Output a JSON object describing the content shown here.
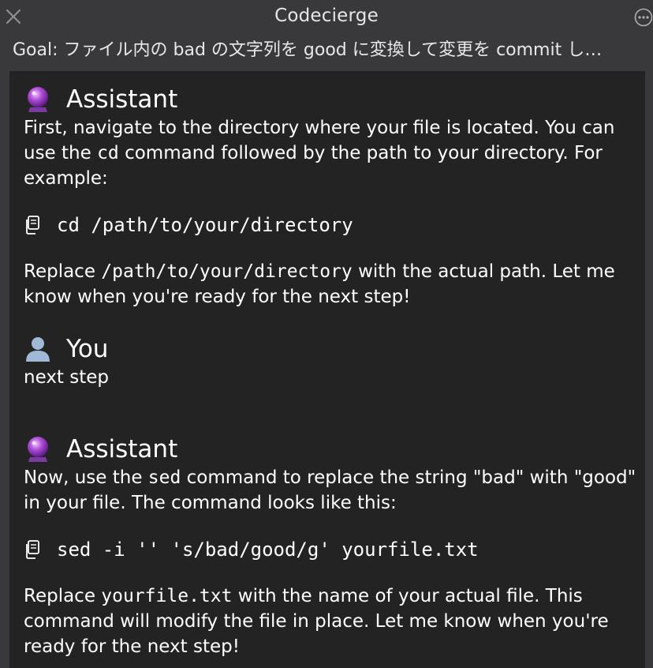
{
  "window": {
    "title": "Codecierge",
    "goal": "Goal: ファイル内の bad の文字列を good に変換して変更を commit し…"
  },
  "messages": [
    {
      "speaker": "Assistant",
      "icon": "crystal-ball-icon",
      "text1": "First, navigate to the directory where your file is located. You can use the ",
      "inline_code1": "cd",
      "text1b": " command followed by the path to your directory. For example:",
      "code": "cd /path/to/your/directory",
      "text2a": "Replace ",
      "inline_code2": "/path/to/your/directory",
      "text2b": " with the actual path. Let me know when you're ready for the next step!"
    },
    {
      "speaker": "You",
      "icon": "user-silhouette-icon",
      "text": "next step"
    },
    {
      "speaker": "Assistant",
      "icon": "crystal-ball-icon",
      "text1a": "Now, use the ",
      "inline_code1": "sed",
      "text1b": " command to replace the string \"bad\" with \"good\" in your file. The command looks like this:",
      "code": "sed -i '' 's/bad/good/g' yourfile.txt",
      "text2a": "Replace ",
      "inline_code2": "yourfile.txt",
      "text2b": " with the name of your actual file. This command will modify the file in place. Let me know when you're ready for the next step!"
    }
  ]
}
